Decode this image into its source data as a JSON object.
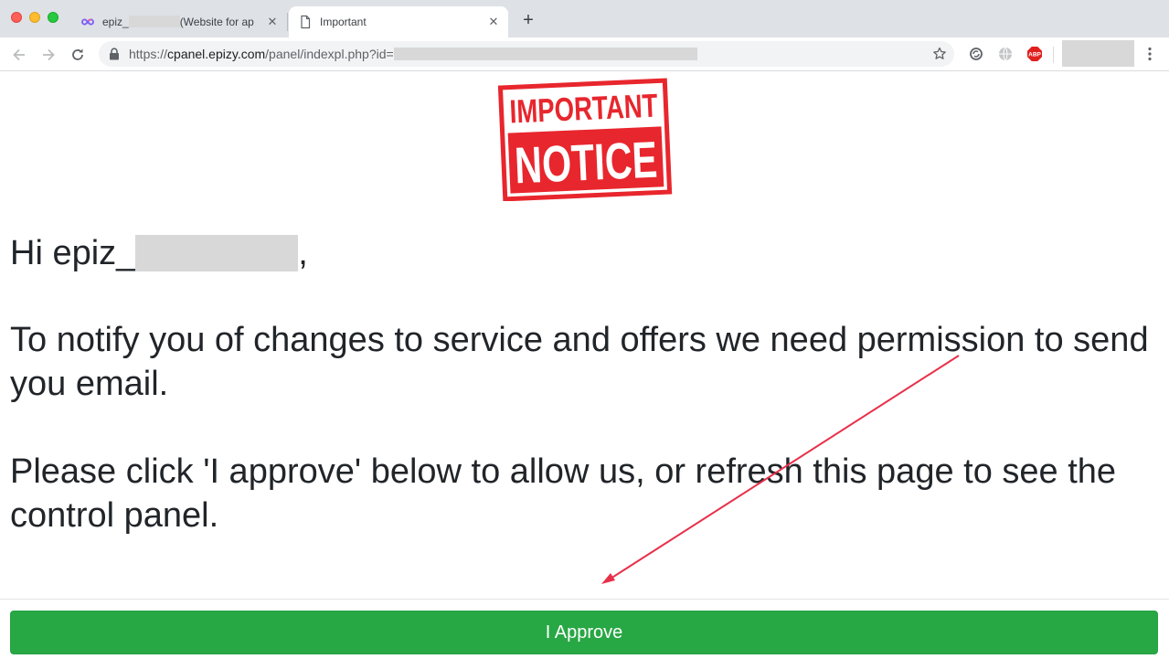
{
  "browser": {
    "tabs": [
      {
        "title_prefix": "epiz_",
        "title_suffix": "(Website for ap",
        "icon": "infinity-favicon-icon",
        "active": false
      },
      {
        "title": "Important",
        "icon": "page-favicon-icon",
        "active": true
      }
    ],
    "address": {
      "scheme": "https://",
      "host": "cpanel.epizy.com",
      "path": "/panel/indexpl.php?id="
    },
    "extensions": [
      "sync-icon",
      "globe-icon",
      "adblock-plus-icon"
    ],
    "adblock_label": "ABP"
  },
  "page": {
    "notice_image": {
      "line1": "IMPORTANT",
      "line2": "NOTICE",
      "color": "#e8262d"
    },
    "greeting_prefix": "Hi epiz_",
    "greeting_suffix": ",",
    "paragraph1": "To notify you of changes to service and offers we need permission to send you email.",
    "paragraph2": "Please click 'I approve' below to allow us, or refresh this page to see the control panel.",
    "approve_button": "I Approve",
    "button_color": "#28a745",
    "annotation_color": "#e8304a"
  }
}
